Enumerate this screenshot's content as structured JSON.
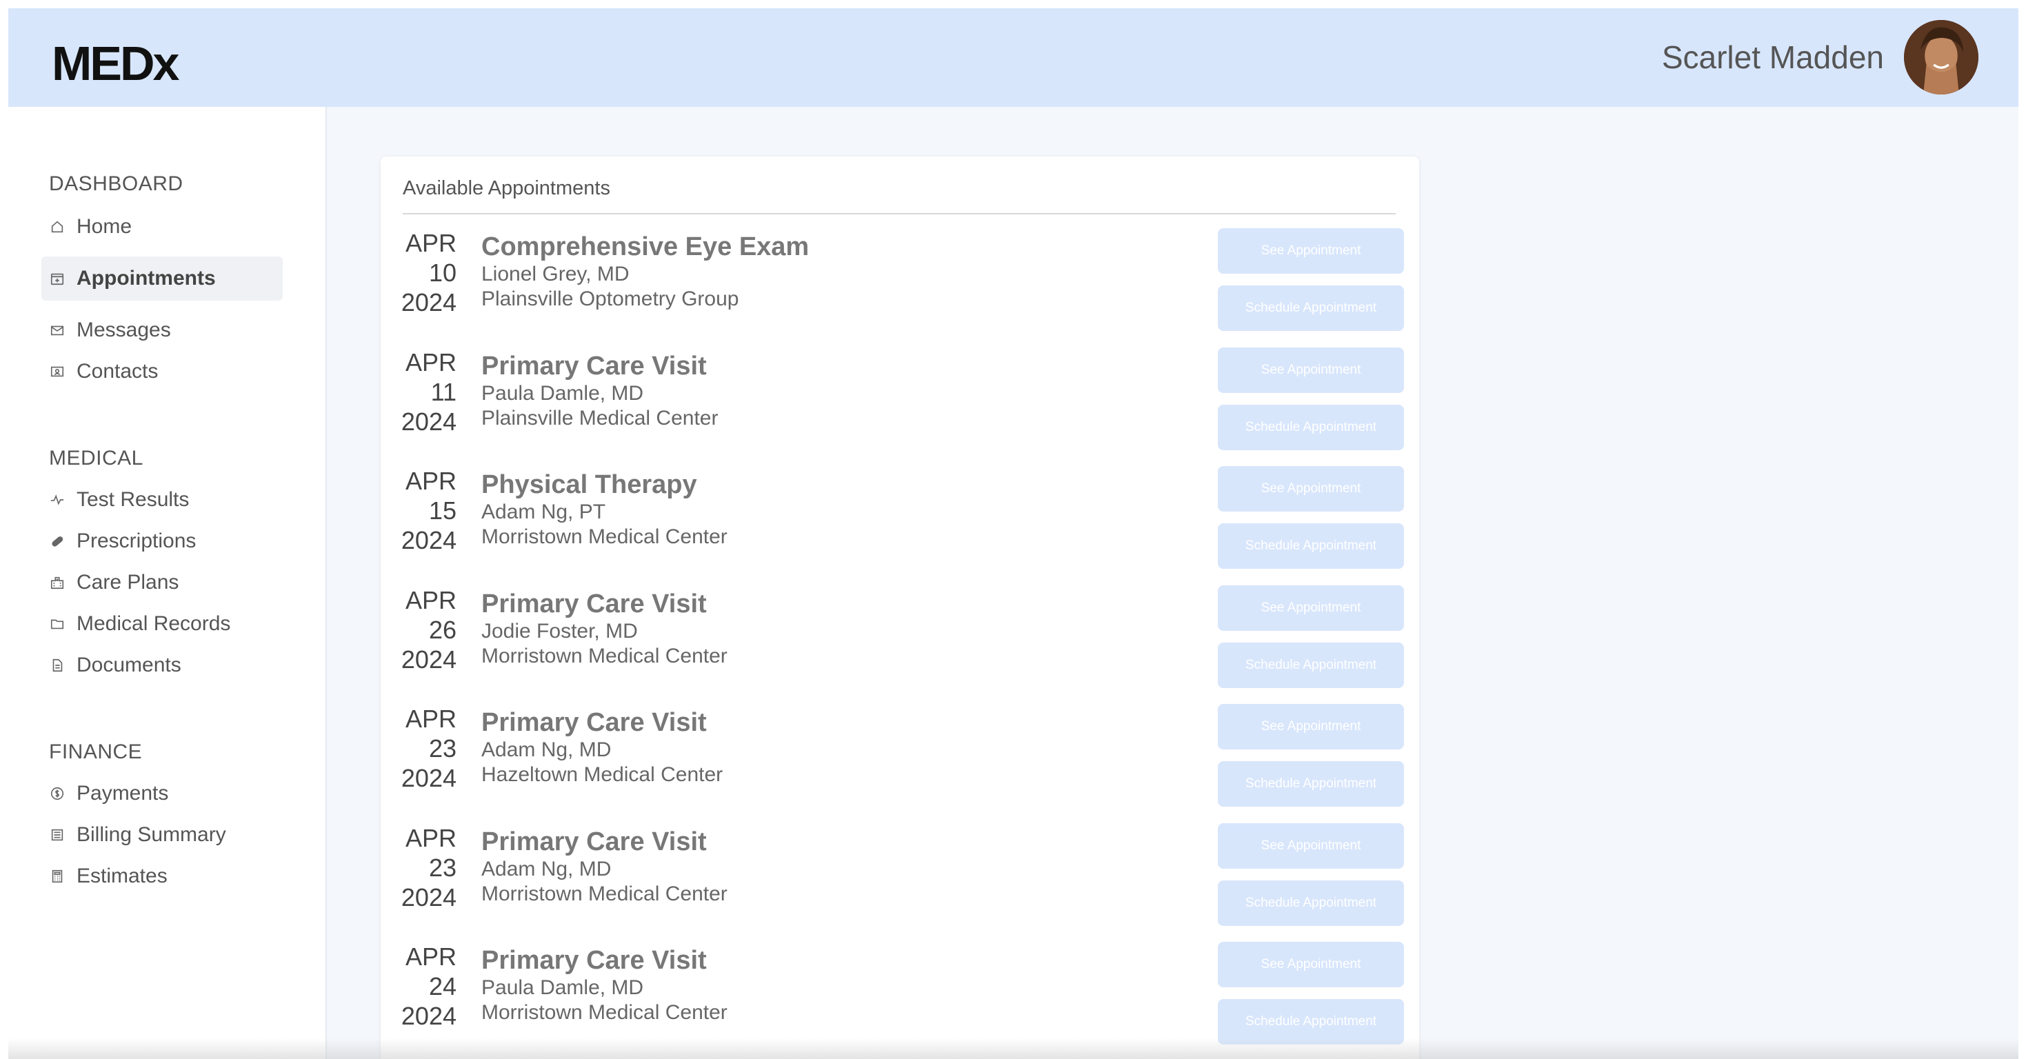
{
  "header": {
    "logo": "MEDx",
    "user_name": "Scarlet Madden"
  },
  "sidebar": {
    "sections": [
      {
        "title": "DASHBOARD",
        "items": [
          {
            "label": "Home",
            "icon": "home-icon"
          },
          {
            "label": "Appointments",
            "icon": "calendar-icon",
            "active": true
          },
          {
            "label": "Messages",
            "icon": "mail-icon"
          },
          {
            "label": "Contacts",
            "icon": "contact-card-icon"
          }
        ]
      },
      {
        "title": "MEDICAL",
        "items": [
          {
            "label": "Test Results",
            "icon": "activity-icon"
          },
          {
            "label": "Prescriptions",
            "icon": "pill-icon"
          },
          {
            "label": "Care Plans",
            "icon": "hospital-icon"
          },
          {
            "label": "Medical Records",
            "icon": "folder-icon"
          },
          {
            "label": "Documents",
            "icon": "document-icon"
          }
        ]
      },
      {
        "title": "FINANCE",
        "items": [
          {
            "label": "Payments",
            "icon": "dollar-circle-icon"
          },
          {
            "label": "Billing Summary",
            "icon": "receipt-icon"
          },
          {
            "label": "Estimates",
            "icon": "calculator-icon"
          }
        ]
      }
    ]
  },
  "main": {
    "card_title": "Available Appointments",
    "see_label": "See Appointment",
    "schedule_label": "Schedule Appointment",
    "appointments": [
      {
        "month": "APR",
        "day": "10",
        "year": "2024",
        "title": "Comprehensive Eye Exam",
        "provider": "Lionel Grey, MD",
        "location": "Plainsville Optometry Group"
      },
      {
        "month": "APR",
        "day": "11",
        "year": "2024",
        "title": "Primary Care Visit",
        "provider": "Paula Damle, MD",
        "location": "Plainsville Medical Center"
      },
      {
        "month": "APR",
        "day": "15",
        "year": "2024",
        "title": "Physical Therapy",
        "provider": "Adam Ng, PT",
        "location": "Morristown Medical Center"
      },
      {
        "month": "APR",
        "day": "26",
        "year": "2024",
        "title": "Primary Care Visit",
        "provider": "Jodie Foster, MD",
        "location": "Morristown Medical Center"
      },
      {
        "month": "APR",
        "day": "23",
        "year": "2024",
        "title": "Primary Care Visit",
        "provider": "Adam Ng, MD",
        "location": "Hazeltown Medical Center"
      },
      {
        "month": "APR",
        "day": "23",
        "year": "2024",
        "title": "Primary Care Visit",
        "provider": "Adam Ng, MD",
        "location": "Morristown Medical Center"
      },
      {
        "month": "APR",
        "day": "24",
        "year": "2024",
        "title": "Primary Care Visit",
        "provider": "Paula Damle, MD",
        "location": "Morristown Medical Center"
      }
    ]
  },
  "colors": {
    "header_bg": "#d8e6fc",
    "button_bg": "#d8e6fc",
    "active_nav_bg": "#f0f1f4"
  }
}
